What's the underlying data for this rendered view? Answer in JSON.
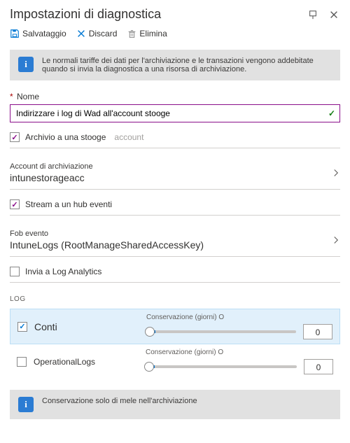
{
  "header": {
    "title": "Impostazioni di diagnostica"
  },
  "toolbar": {
    "save_label": "Salvataggio",
    "discard_label": "Discard",
    "delete_label": "Elimina"
  },
  "info_box_1": "Le normali tariffe dei dati per l'archiviazione e le transazioni vengono addebitate quando si invia la diagnostica a una risorsa di archiviazione.",
  "name_field": {
    "label": "Nome",
    "value": "Indirizzare i log di Wad all'account stooge"
  },
  "archive_checkbox": {
    "label": "Archivio a una stooge",
    "hint": "account",
    "checked": true
  },
  "storage_picker": {
    "label": "Account di archiviazione",
    "value": "intunestorageacc"
  },
  "stream_checkbox": {
    "label": "Stream a un hub eventi",
    "checked": true
  },
  "eventhub_picker": {
    "label": "Fob evento",
    "value": "IntuneLogs (RootManageSharedAccessKey)"
  },
  "loganalytics_checkbox": {
    "label": "Invia a Log Analytics",
    "checked": false
  },
  "log_section": {
    "heading": "LOG",
    "retention_label": "Conservazione (giorni) O",
    "rows": [
      {
        "name": "Conti",
        "checked": true,
        "retention": "0"
      },
      {
        "name": "OperationalLogs",
        "checked": false,
        "retention": "0"
      }
    ]
  },
  "info_box_2": "Conservazione solo di mele nell'archiviazione"
}
